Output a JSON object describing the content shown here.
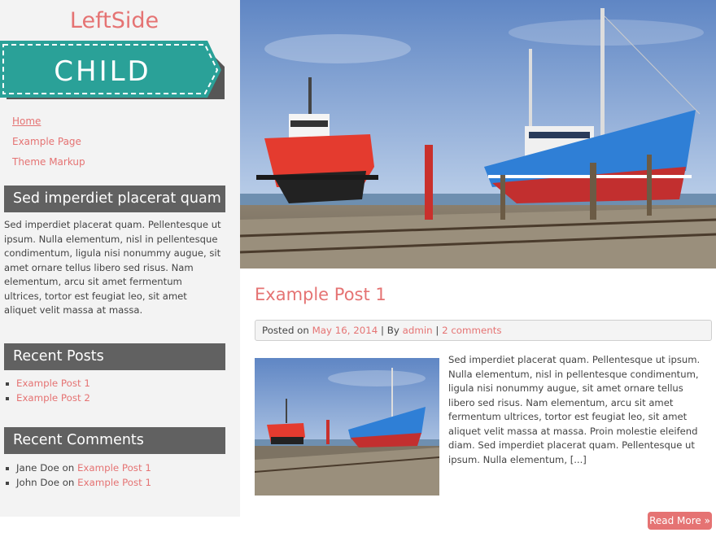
{
  "site": {
    "title": "LeftSide",
    "logo_text": "CHILD"
  },
  "colors": {
    "accent": "#e57373",
    "ribbon": "#2aa198",
    "widget_bg": "#616161",
    "sidebar_bg": "#f3f3f3"
  },
  "menu": [
    {
      "label": "Home"
    },
    {
      "label": "Example Page"
    },
    {
      "label": "Theme Markup"
    }
  ],
  "widgets": {
    "text_widget": {
      "title": "Sed imperdiet placerat quam",
      "body": "Sed imperdiet placerat quam. Pellentesque ut ipsum. Nulla elementum, nisl in pellentesque condimentum, ligula nisi nonummy augue, sit amet ornare tellus libero sed risus. Nam elementum, arcu sit amet fermentum ultrices, tortor est feugiat leo, sit amet aliquet velit massa at massa."
    },
    "recent_posts": {
      "title": "Recent Posts",
      "items": [
        {
          "label": "Example Post 1"
        },
        {
          "label": "Example Post 2"
        }
      ]
    },
    "recent_comments": {
      "title": "Recent Comments",
      "items": [
        {
          "author": "Jane Doe",
          "on": "on",
          "post": "Example Post 1"
        },
        {
          "author": "John Doe",
          "on": "on",
          "post": "Example Post 1"
        }
      ]
    }
  },
  "post": {
    "title": "Example Post 1",
    "meta": {
      "posted_on": "Posted on",
      "date": "May 16, 2014",
      "sep1": "|",
      "by": "By",
      "author": "admin",
      "sep2": "|",
      "comments": "2 comments"
    },
    "excerpt": "Sed imperdiet placerat quam. Pellentesque ut ipsum. Nulla elementum, nisl in pellentesque condimentum, ligula nisi nonummy augue, sit amet ornare tellus libero sed risus. Nam elementum, arcu sit amet fermentum ultrices, tortor est feugiat leo, sit amet aliquet velit massa at massa. Proin molestie eleifend diam. Sed imperdiet placerat quam. Pellentesque ut ipsum. Nulla elementum, [...]",
    "read_more": "Read More »"
  }
}
